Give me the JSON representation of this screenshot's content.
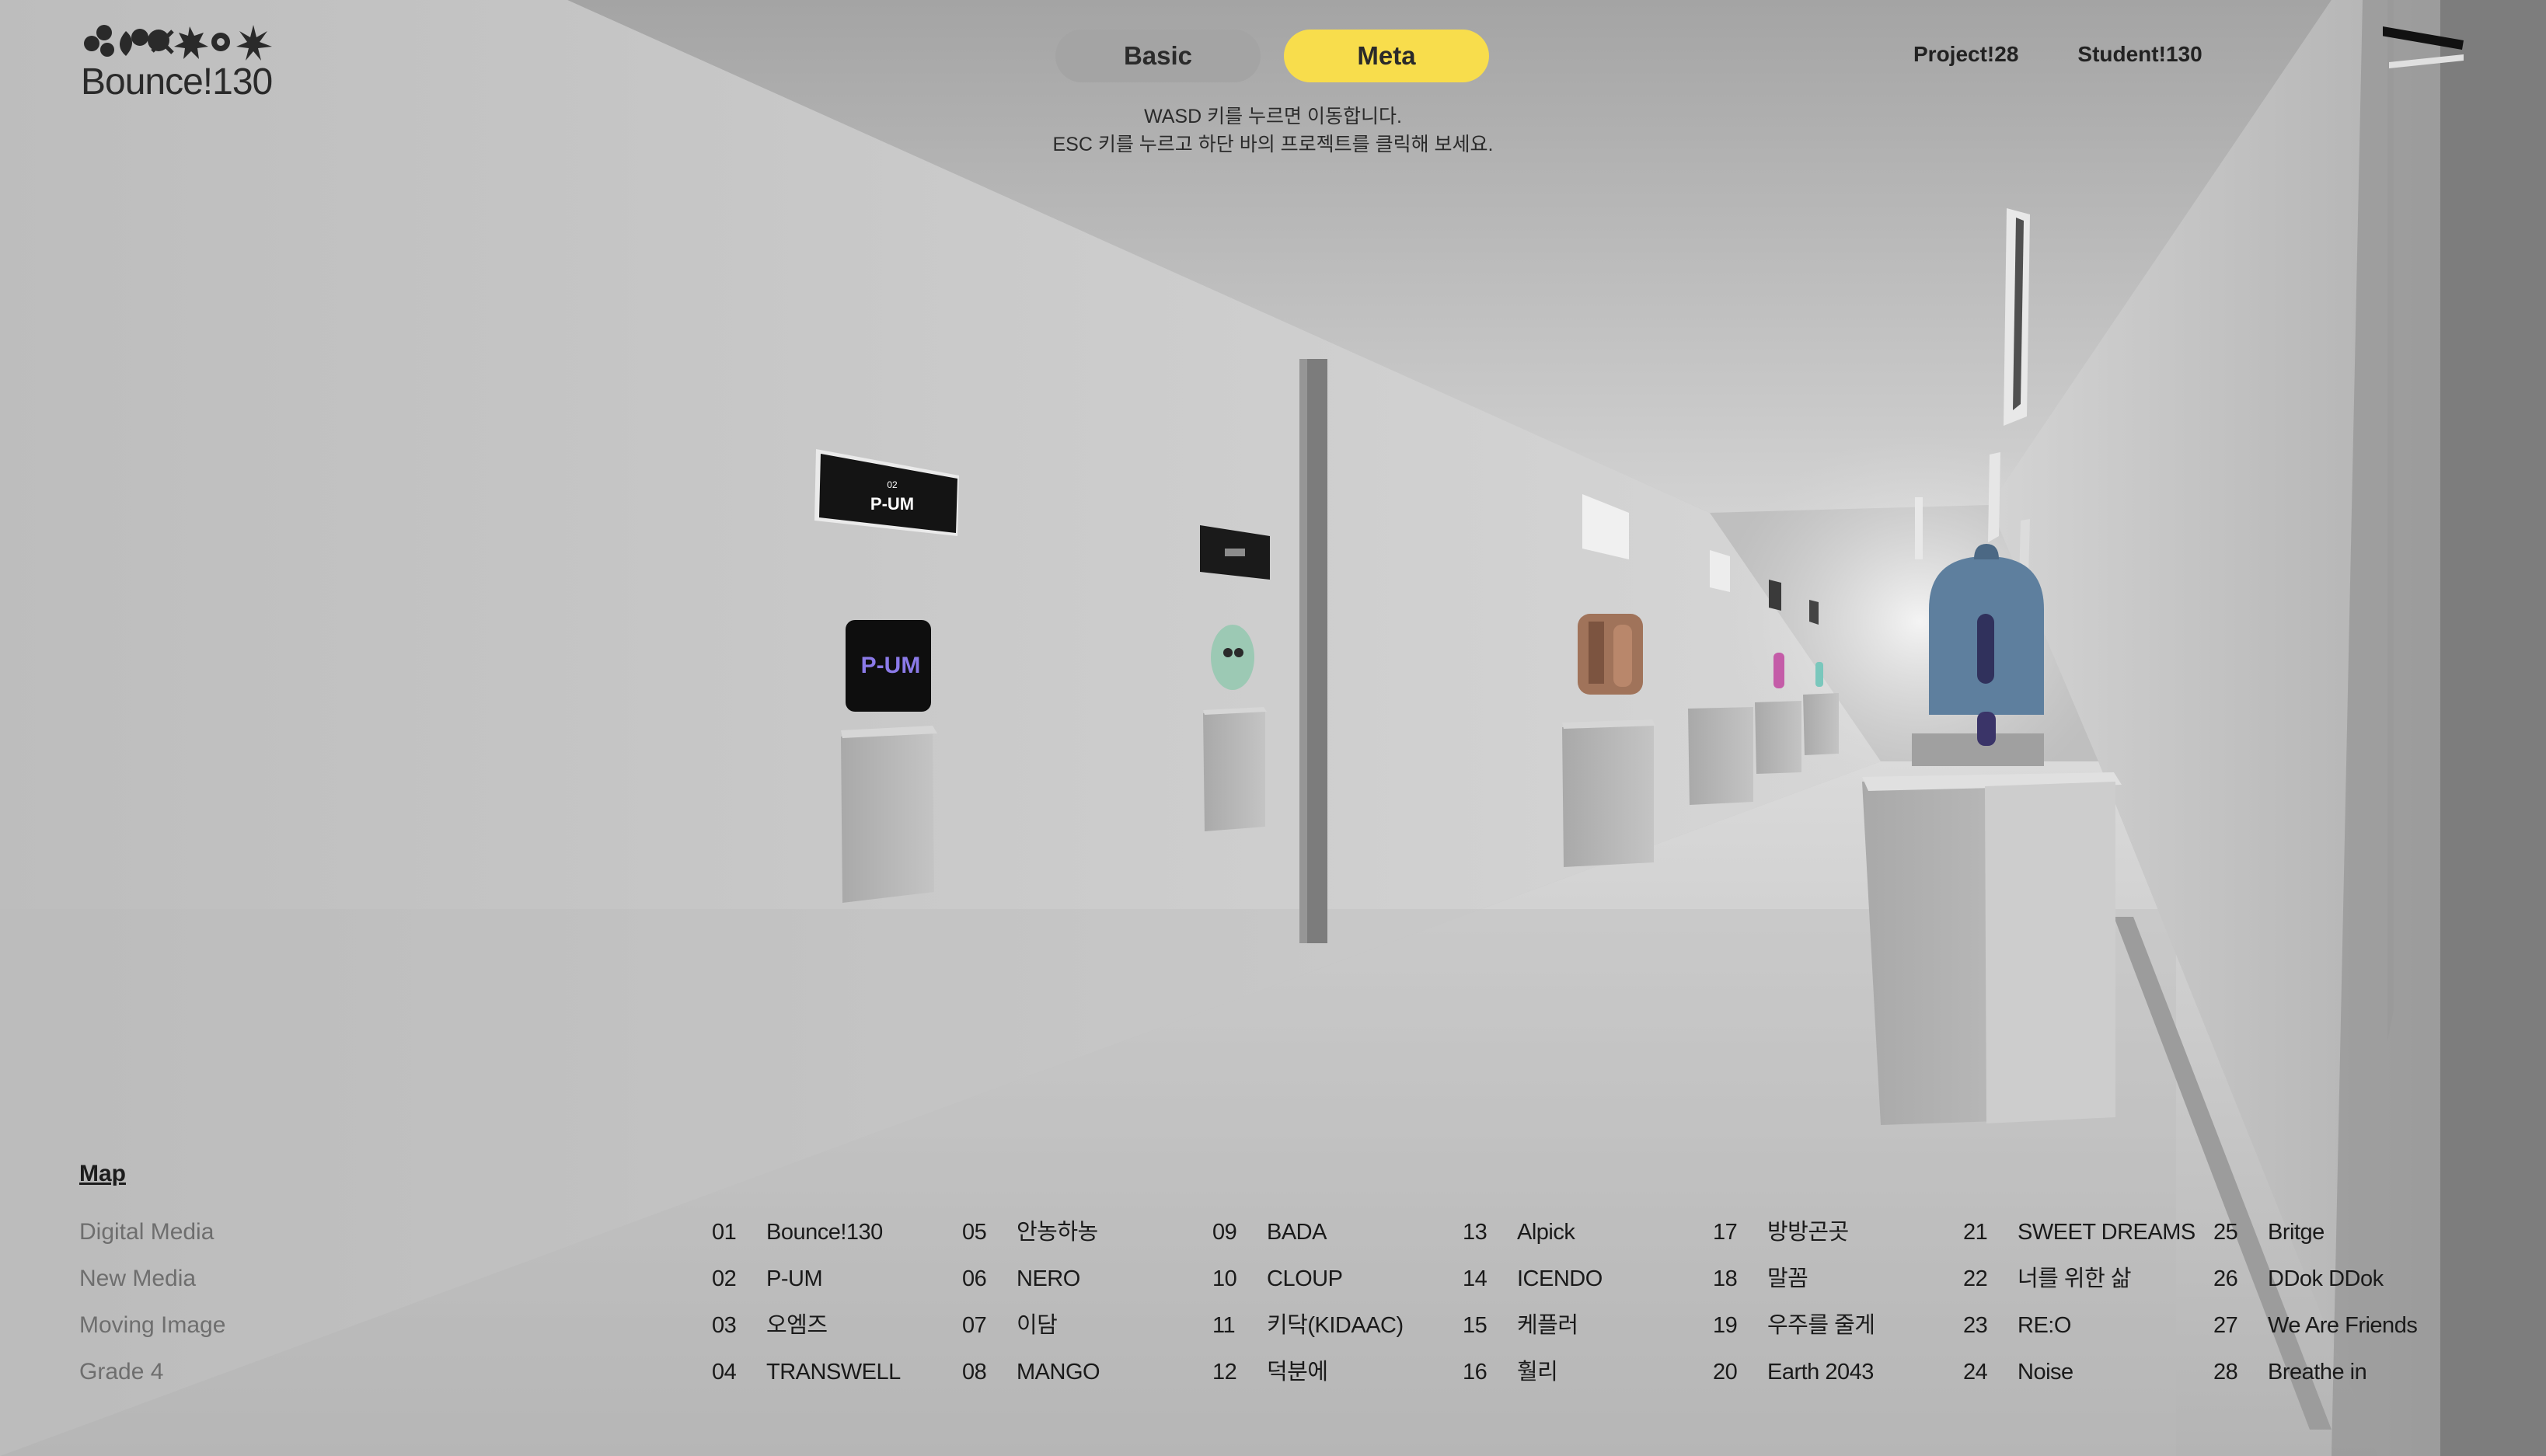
{
  "brand": {
    "name": "Bounce!130"
  },
  "modes": {
    "basic": "Basic",
    "meta": "Meta",
    "active": "Meta"
  },
  "hint": {
    "line1": "WASD 키를 누르면 이동합니다.",
    "line2": "ESC 키를 누르고 하단 바의 프로젝트를 클릭해 보세요."
  },
  "nav": {
    "projects": "Project!28",
    "students": "Student!130"
  },
  "scene_labels": {
    "sign_number": "02",
    "sign_title": "P-UM",
    "screen_text": "P-UM"
  },
  "map": {
    "title": "Map",
    "categories": [
      "Digital Media",
      "New Media",
      "Moving Image",
      "Grade 4"
    ],
    "projects": [
      {
        "num": "01",
        "name": "Bounce!130"
      },
      {
        "num": "02",
        "name": "P-UM"
      },
      {
        "num": "03",
        "name": "오엠즈"
      },
      {
        "num": "04",
        "name": "TRANSWELL"
      },
      {
        "num": "05",
        "name": "안농하농"
      },
      {
        "num": "06",
        "name": "NERO"
      },
      {
        "num": "07",
        "name": "이담"
      },
      {
        "num": "08",
        "name": "MANGO"
      },
      {
        "num": "09",
        "name": "BADA"
      },
      {
        "num": "10",
        "name": "CLOUP"
      },
      {
        "num": "11",
        "name": "키닥(KIDAAC)"
      },
      {
        "num": "12",
        "name": "덕분에"
      },
      {
        "num": "13",
        "name": "Alpick"
      },
      {
        "num": "14",
        "name": "ICENDO"
      },
      {
        "num": "15",
        "name": "케플러"
      },
      {
        "num": "16",
        "name": "훨리"
      },
      {
        "num": "17",
        "name": "방방곤곳"
      },
      {
        "num": "18",
        "name": "말꼼"
      },
      {
        "num": "19",
        "name": "우주를 줄게"
      },
      {
        "num": "20",
        "name": "Earth 2043"
      },
      {
        "num": "21",
        "name": "SWEET DREAMS"
      },
      {
        "num": "22",
        "name": "너를 위한 삶"
      },
      {
        "num": "23",
        "name": "RE:O"
      },
      {
        "num": "24",
        "name": "Noise"
      },
      {
        "num": "25",
        "name": "Britge"
      },
      {
        "num": "26",
        "name": "DDok DDok"
      },
      {
        "num": "27",
        "name": "We Are Friends"
      },
      {
        "num": "28",
        "name": "Breathe in"
      }
    ]
  },
  "colors": {
    "accent": "#f8dd4c",
    "wall": "#c9c9c9",
    "floor": "#c2c2c2"
  }
}
